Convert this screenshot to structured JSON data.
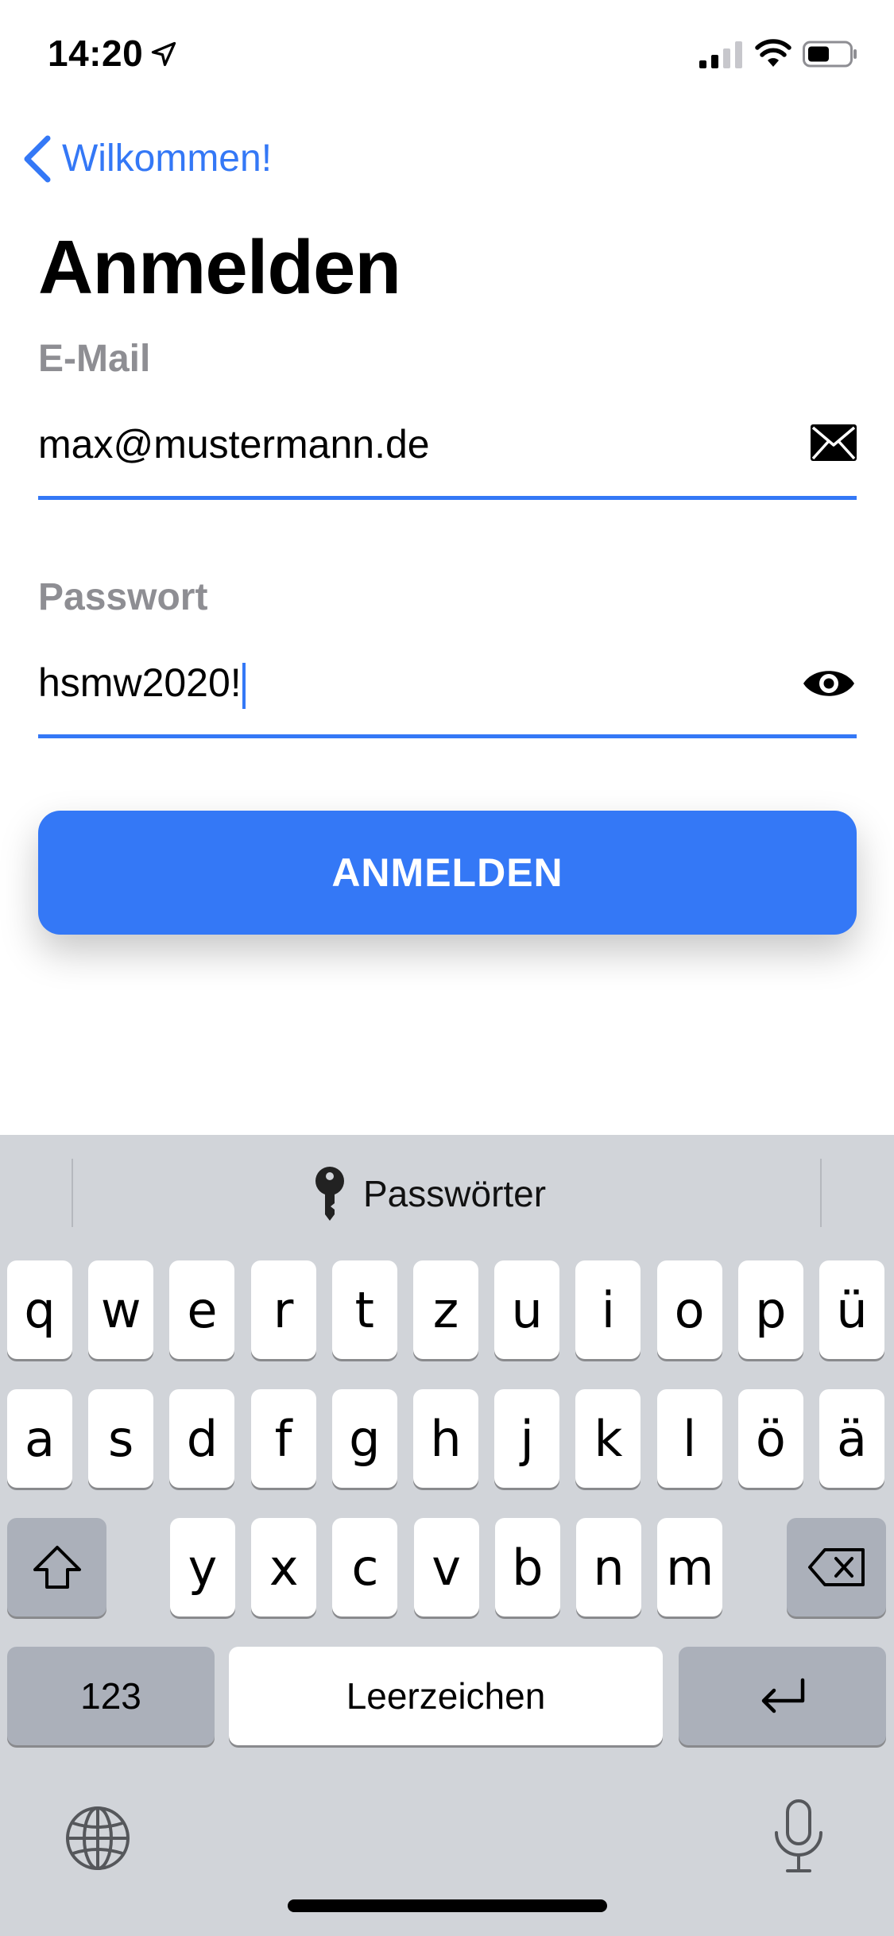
{
  "status_bar": {
    "time": "14:20"
  },
  "nav": {
    "back_label": "Wilkommen!"
  },
  "page": {
    "title": "Anmelden"
  },
  "form": {
    "email": {
      "label": "E-Mail",
      "value": "max@mustermann.de",
      "icon": "envelope-icon"
    },
    "password": {
      "label": "Passwort",
      "value": "hsmw2020!",
      "icon": "eye-icon"
    },
    "submit_label": "ANMELDEN"
  },
  "keyboard": {
    "suggestion_label": "Passwörter",
    "row1": [
      "q",
      "w",
      "e",
      "r",
      "t",
      "z",
      "u",
      "i",
      "o",
      "p",
      "ü"
    ],
    "row2": [
      "a",
      "s",
      "d",
      "f",
      "g",
      "h",
      "j",
      "k",
      "l",
      "ö",
      "ä"
    ],
    "row3": [
      "y",
      "x",
      "c",
      "v",
      "b",
      "n",
      "m"
    ],
    "numbers_label": "123",
    "space_label": "Leerzeichen"
  },
  "colors": {
    "accent": "#3478f6",
    "keyboard_bg": "#d1d4d9",
    "label_gray": "#8e8e93"
  }
}
